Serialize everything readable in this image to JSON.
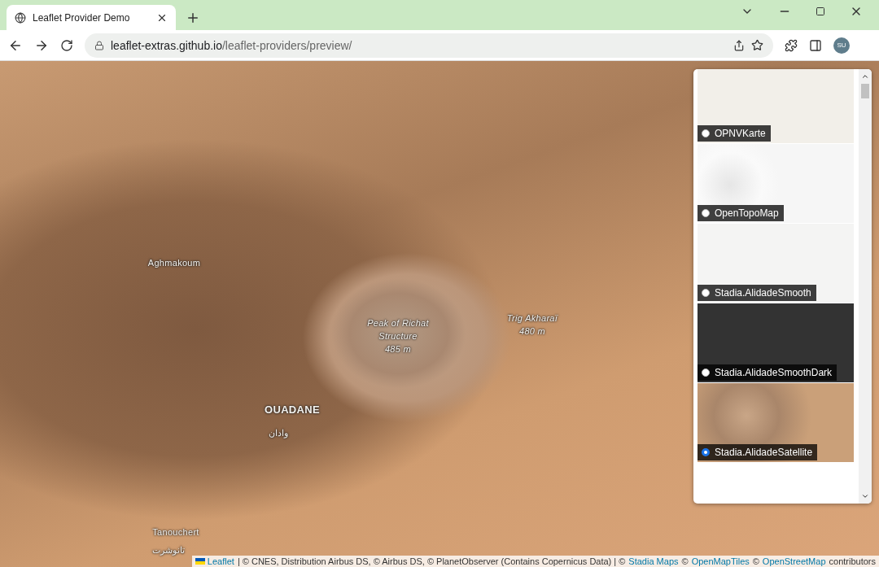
{
  "browser": {
    "tab": {
      "title": "Leaflet Provider Demo"
    },
    "address": {
      "host": "leaflet-extras.github.io",
      "path": "/leaflet-providers/preview/"
    },
    "profile": "SU"
  },
  "map": {
    "labels": [
      {
        "kind": "place",
        "lines": [
          "Aghmakoum"
        ]
      },
      {
        "kind": "peak",
        "lines": [
          "Peak of Richat",
          "Structure",
          "485 m"
        ]
      },
      {
        "kind": "peak",
        "lines": [
          "Trig Akharaï",
          "480 m"
        ]
      },
      {
        "kind": "town",
        "lines": [
          "OUADANE"
        ]
      },
      {
        "kind": "place",
        "lines": [
          "وادان"
        ]
      },
      {
        "kind": "place",
        "lines": [
          "Tanouchert"
        ]
      },
      {
        "kind": "place",
        "lines": [
          "تانوشرت"
        ]
      }
    ]
  },
  "layers": [
    {
      "name": "OPNVKarte",
      "kind": "light",
      "selected": false
    },
    {
      "name": "OpenTopoMap",
      "kind": "hillshade",
      "selected": false
    },
    {
      "name": "Stadia.AlidadeSmooth",
      "kind": "smooth",
      "selected": false
    },
    {
      "name": "Stadia.AlidadeSmoothDark",
      "kind": "dark",
      "selected": false
    },
    {
      "name": "Stadia.AlidadeSatellite",
      "kind": "satellite",
      "selected": true
    }
  ],
  "attribution": [
    {
      "kind": "flag-link",
      "text": "Leaflet"
    },
    {
      "kind": "text",
      "text": "| © CNES, Distribution Airbus DS, © Airbus DS, © PlanetObserver (Contains Copernicus Data) | ©"
    },
    {
      "kind": "link",
      "text": "Stadia Maps"
    },
    {
      "kind": "text",
      "text": "©"
    },
    {
      "kind": "link",
      "text": "OpenMapTiles"
    },
    {
      "kind": "text",
      "text": "©"
    },
    {
      "kind": "link",
      "text": "OpenStreetMap"
    },
    {
      "kind": "text",
      "text": "contributors"
    }
  ]
}
